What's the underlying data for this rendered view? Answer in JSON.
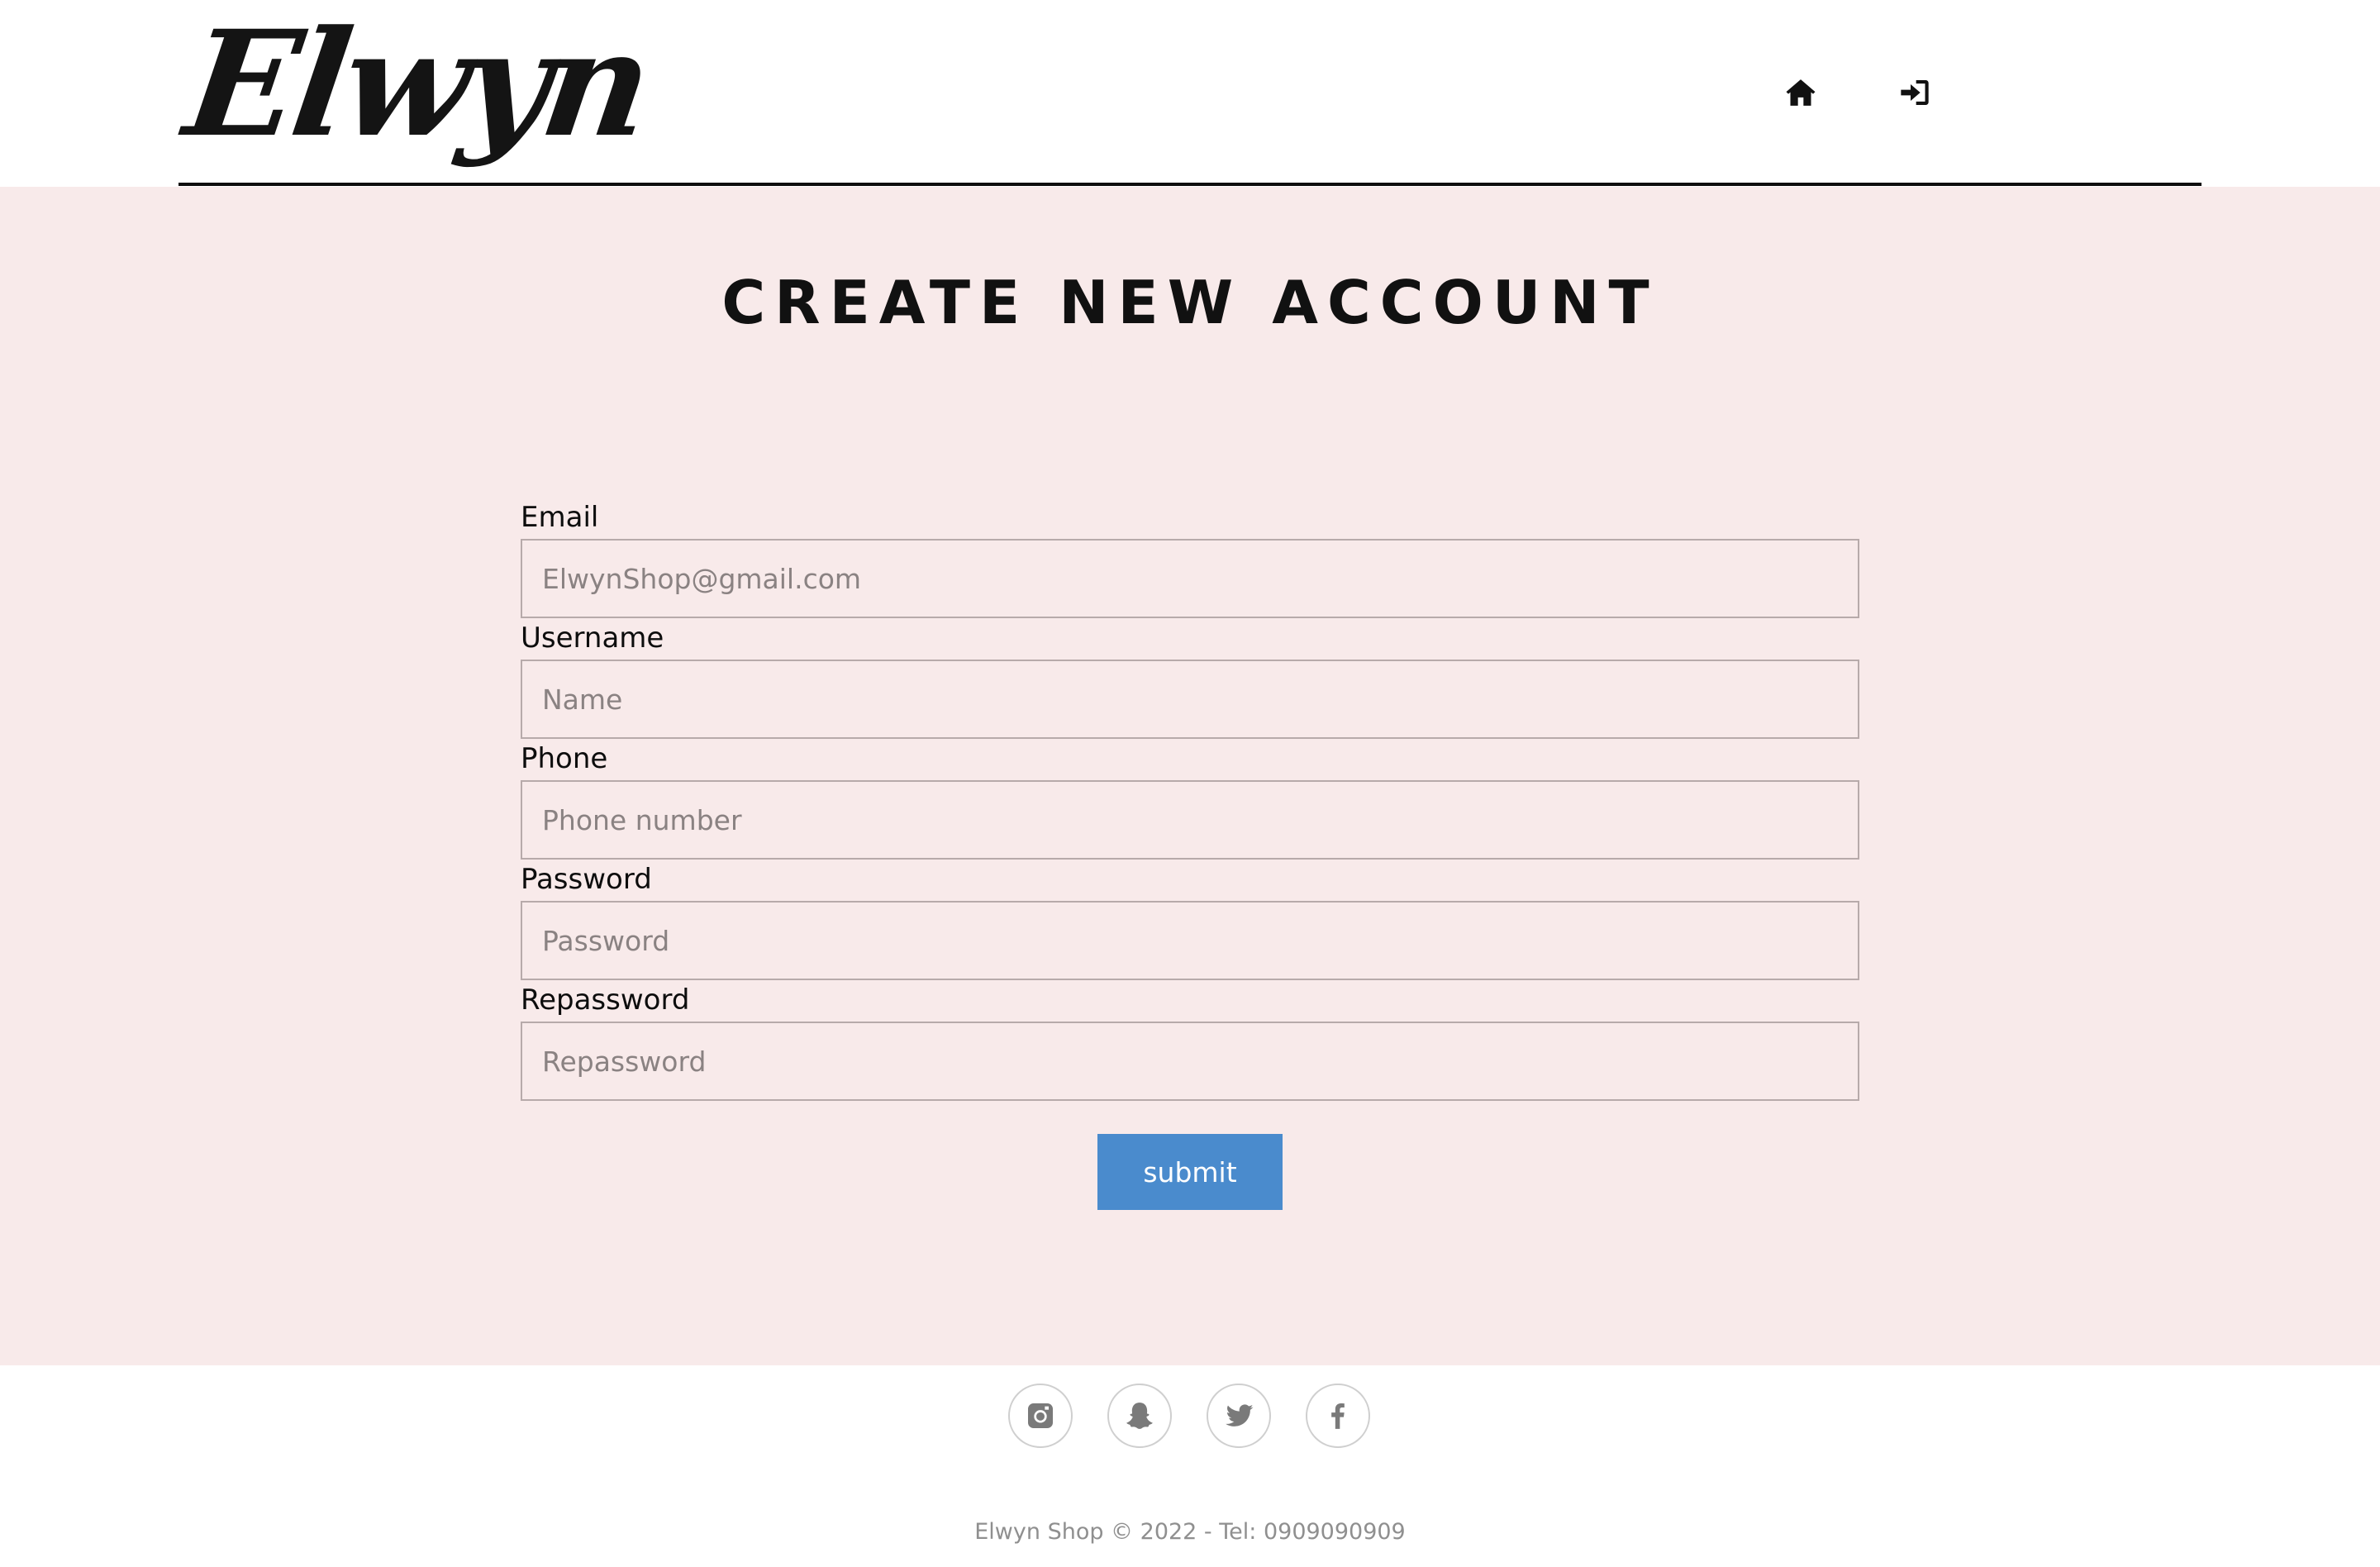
{
  "header": {
    "logo_text": "Elwyn",
    "nav": [
      {
        "icon": "home-icon"
      },
      {
        "icon": "sign-in-icon"
      }
    ]
  },
  "main": {
    "title": "CREATE NEW ACCOUNT",
    "fields": [
      {
        "label": "Email",
        "placeholder": "ElwynShop@gmail.com",
        "value": ""
      },
      {
        "label": "Username",
        "placeholder": "Name",
        "value": ""
      },
      {
        "label": "Phone",
        "placeholder": "Phone number",
        "value": ""
      },
      {
        "label": "Password",
        "placeholder": "Password",
        "value": ""
      },
      {
        "label": "Repassword",
        "placeholder": "Repassword",
        "value": ""
      }
    ],
    "submit_label": "submit"
  },
  "footer": {
    "social": [
      {
        "icon": "instagram-icon"
      },
      {
        "icon": "snapchat-icon"
      },
      {
        "icon": "twitter-icon"
      },
      {
        "icon": "facebook-icon"
      }
    ],
    "copyright": "Elwyn Shop © 2022 - Tel: 0909090909"
  },
  "colors": {
    "page_background": "#f8eaea",
    "submit_button": "#4a8bcd",
    "social_icon": "#7a7a7a"
  }
}
